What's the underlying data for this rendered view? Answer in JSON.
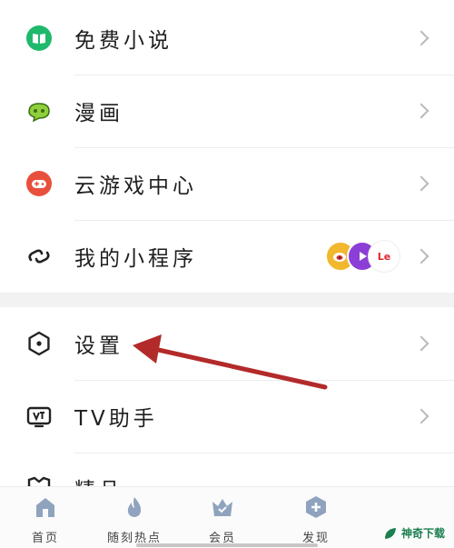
{
  "menu": {
    "items": [
      {
        "label": "免费小说",
        "icon": "book-icon",
        "color": "#1fb96c"
      },
      {
        "label": "漫画",
        "icon": "comic-icon",
        "color": "#6aa62b"
      },
      {
        "label": "云游戏中心",
        "icon": "gamepad-icon",
        "color": "#e8503d"
      },
      {
        "label": "我的小程序",
        "icon": "link-icon",
        "color": "#222222"
      },
      {
        "label": "设置",
        "icon": "hexagon-settings-icon",
        "color": "#222222"
      },
      {
        "label": "TV助手",
        "icon": "tv-icon",
        "color": "#222222"
      }
    ],
    "partial_label": "精品",
    "mini_program_badges": [
      {
        "name": "weibo-badge",
        "text": "",
        "color": "#f1b72d"
      },
      {
        "name": "play-badge",
        "text": "",
        "color": "#8b3fd6"
      },
      {
        "name": "le-badge",
        "text": "Le",
        "color": "#ffffff"
      }
    ]
  },
  "tabbar": {
    "tabs": [
      {
        "label": "首页",
        "icon": "home-icon"
      },
      {
        "label": "随刻热点",
        "icon": "flame-icon"
      },
      {
        "label": "会员",
        "icon": "crown-icon"
      },
      {
        "label": "发现",
        "icon": "plus-icon"
      }
    ]
  },
  "watermark": {
    "text": "神奇下载"
  },
  "annotation": {
    "color": "#b32a2a"
  }
}
